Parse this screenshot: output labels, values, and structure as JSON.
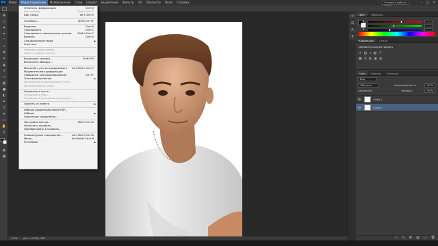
{
  "app": {
    "logo": "Ps"
  },
  "menubar": {
    "items": [
      "Файл",
      "Редактирование",
      "Изображение",
      "Слои",
      "Шрифт",
      "Выделение",
      "Фильтр",
      "3D",
      "Просмотр",
      "Окно",
      "Справка"
    ],
    "active_index": 1,
    "workspace": "Основная рабочая среда"
  },
  "edit_menu": {
    "items": [
      {
        "label": "Отменить: Деформация",
        "shortcut": "Ctrl+Z",
        "disabled": false
      },
      {
        "label": "Шаг вперед",
        "shortcut": "Shift+Ctrl+Z",
        "disabled": true
      },
      {
        "label": "Шаг назад",
        "shortcut": "Alt+Ctrl+Z",
        "disabled": false
      },
      {
        "sep": true
      },
      {
        "label": "Ослабить...",
        "shortcut": "Shift+Ctrl+F",
        "disabled": false
      },
      {
        "sep": true
      },
      {
        "label": "Вырезать",
        "shortcut": "Ctrl+X",
        "disabled": false
      },
      {
        "label": "Скопировать",
        "shortcut": "Ctrl+C",
        "disabled": false
      },
      {
        "label": "Скопировать совмещенные данные",
        "shortcut": "Shift+Ctrl+C",
        "disabled": false
      },
      {
        "label": "Вклеить",
        "shortcut": "Ctrl+V",
        "disabled": false
      },
      {
        "label": "Специальная вставка",
        "shortcut": "",
        "submenu": true,
        "disabled": false
      },
      {
        "label": "Очистить",
        "shortcut": "",
        "disabled": false
      },
      {
        "sep": true
      },
      {
        "label": "Проверка орфографии...",
        "shortcut": "",
        "disabled": true
      },
      {
        "label": "Поиск и замена текста...",
        "shortcut": "",
        "disabled": true
      },
      {
        "sep": true
      },
      {
        "label": "Выполнить заливку...",
        "shortcut": "Shift+F5",
        "disabled": false
      },
      {
        "label": "Выполнить обводку...",
        "shortcut": "",
        "disabled": false
      },
      {
        "sep": true
      },
      {
        "label": "Масштаб с учетом содержимого",
        "shortcut": "Alt+Shift+Ctrl+C",
        "disabled": false
      },
      {
        "label": "Марионеточная деформация",
        "shortcut": "",
        "disabled": false
      },
      {
        "label": "Свободное трансформирование",
        "shortcut": "Ctrl+T",
        "disabled": false
      },
      {
        "label": "Трансформирование",
        "shortcut": "",
        "submenu": true,
        "disabled": false
      },
      {
        "label": "Автоматически выравнивать слои...",
        "shortcut": "",
        "disabled": true
      },
      {
        "label": "Автоналожение слоев...",
        "shortcut": "",
        "disabled": true
      },
      {
        "sep": true
      },
      {
        "label": "Определить кисть...",
        "shortcut": "",
        "disabled": false
      },
      {
        "label": "Определить узор...",
        "shortcut": "",
        "disabled": true
      },
      {
        "label": "Определить произвольную фигуру...",
        "shortcut": "",
        "disabled": true
      },
      {
        "sep": true
      },
      {
        "label": "Удалить из памяти",
        "shortcut": "",
        "submenu": true,
        "disabled": false
      },
      {
        "sep": true
      },
      {
        "label": "Наборы параметров Adobe PDF...",
        "shortcut": "",
        "disabled": false
      },
      {
        "label": "Наборы",
        "shortcut": "",
        "submenu": true,
        "disabled": false
      },
      {
        "label": "Удаленные соединения...",
        "shortcut": "",
        "disabled": false
      },
      {
        "sep": true
      },
      {
        "label": "Настройка цветов...",
        "shortcut": "Shift+Ctrl+K",
        "disabled": false
      },
      {
        "label": "Назначить профиль...",
        "shortcut": "",
        "disabled": false
      },
      {
        "label": "Преобразовать в профиль...",
        "shortcut": "",
        "disabled": false
      },
      {
        "sep": true
      },
      {
        "label": "Клавиатурные сокращения...",
        "shortcut": "Alt+Shift+Ctrl+K",
        "disabled": false
      },
      {
        "label": "Меню...",
        "shortcut": "Alt+Shift+Ctrl+M",
        "disabled": false
      },
      {
        "label": "Установки",
        "shortcut": "",
        "submenu": true,
        "disabled": false
      }
    ]
  },
  "color_panel": {
    "tabs": [
      "Цвет",
      "Образцы"
    ],
    "channels": [
      {
        "label": "R",
        "value": 0.62,
        "gradient": "linear-gradient(90deg,#000,#f00)"
      },
      {
        "label": "G",
        "value": 0.48,
        "gradient": "linear-gradient(90deg,#000,#0f0)"
      },
      {
        "label": "B",
        "value": 0.4,
        "gradient": "linear-gradient(90deg,#000,#00f)"
      }
    ]
  },
  "adjust_panel": {
    "tabs": [
      "Коррекция",
      "Стили"
    ],
    "title": "Добавить корректировку"
  },
  "layers_panel": {
    "tabs": [
      "Слои",
      "Каналы",
      "Контуры"
    ],
    "kind": "Вид",
    "blend_mode": "Обычные",
    "opacity_label": "Непрозрачность:",
    "opacity": "100%",
    "lock_label": "Закрепить:",
    "fill_label": "Заливка:",
    "fill": "100%",
    "layers": [
      {
        "name": "Слой 1",
        "selected": false
      },
      {
        "name": "Слой 0",
        "selected": true
      }
    ]
  },
  "status": {
    "zoom": "100%",
    "doc": "Док: 1,41M/1,38M"
  },
  "colors": {
    "menu_highlight": "#4a6fa0",
    "layer_selected": "#4a5f80",
    "panel_bg": "#3a3a3a"
  }
}
